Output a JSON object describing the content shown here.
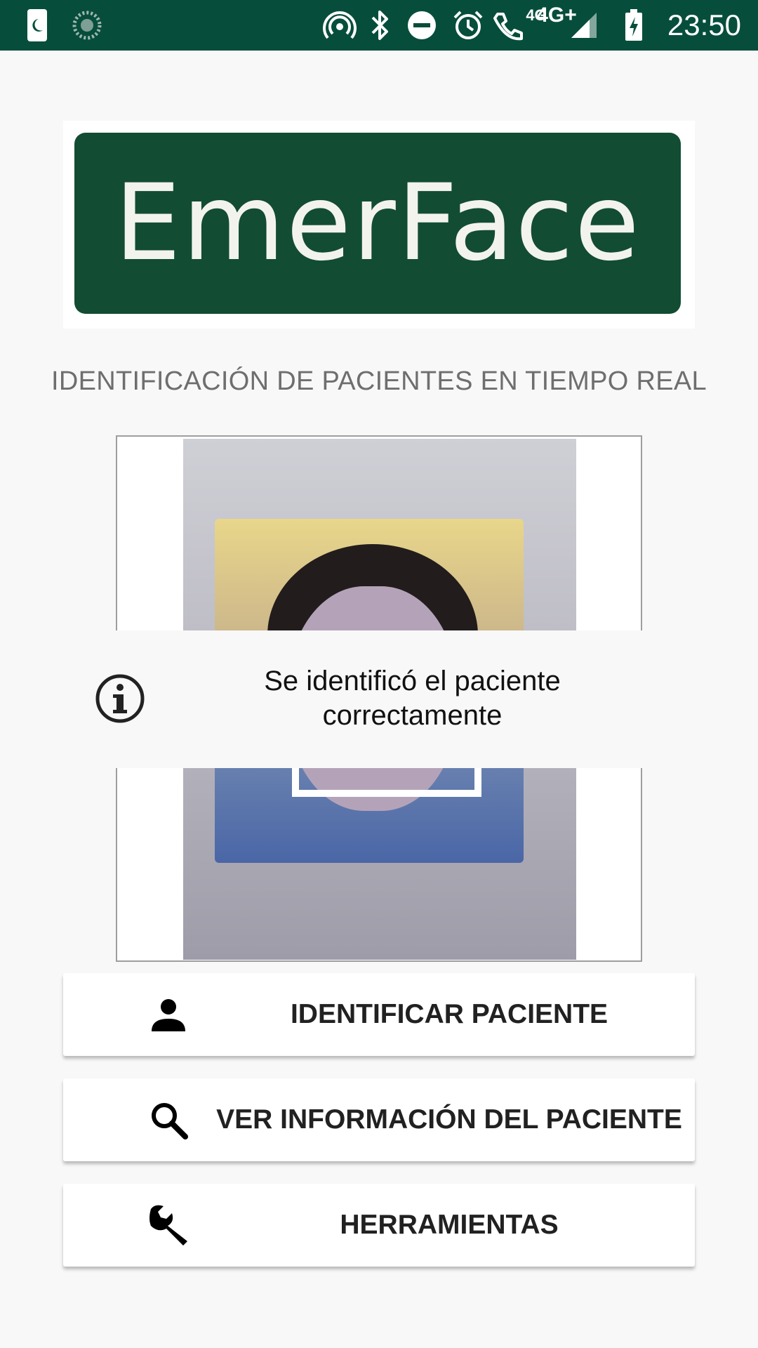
{
  "status_bar": {
    "time": "23:50",
    "network_small": "4G",
    "network_large": "4G+",
    "icons": [
      "moon-app-icon",
      "sync-icon",
      "hotspot-icon",
      "bluetooth-icon",
      "do-not-disturb-icon",
      "alarm-icon",
      "wifi-call-icon",
      "signal-icon",
      "battery-charging-icon"
    ]
  },
  "logo": {
    "text": "EmerFace"
  },
  "subtitle": "IDENTIFICACIÓN DE PACIENTES EN TIEMPO REAL",
  "toast": {
    "message": "Se identificó el paciente correctamente",
    "icon": "info-icon"
  },
  "buttons": [
    {
      "label": "IDENTIFICAR PACIENTE",
      "icon": "person-icon"
    },
    {
      "label": "VER INFORMACIÓN DEL PACIENTE",
      "icon": "search-icon"
    },
    {
      "label": "HERRAMIENTAS",
      "icon": "wrench-icon"
    }
  ],
  "colors": {
    "status_bar": "#064e3b",
    "logo_background": "#124c33",
    "subtitle": "#6e6e6e"
  }
}
